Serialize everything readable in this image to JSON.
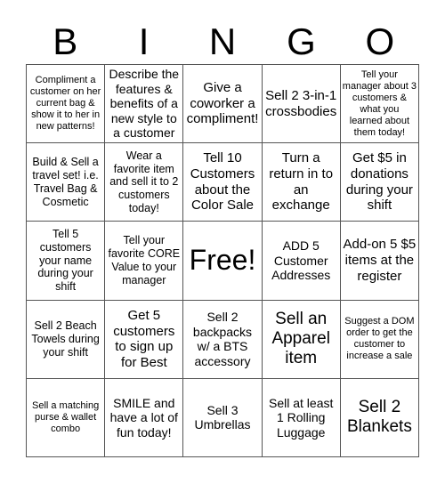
{
  "header": {
    "letters": [
      "B",
      "I",
      "N",
      "G",
      "O"
    ]
  },
  "cells": [
    [
      "Compliment a customer on her current bag & show it to her in new patterns!",
      "Describe the features & benefits of a new style to a customer",
      "Give a coworker a compliment!",
      "Sell 2 3-in-1 crossbodies",
      "Tell your manager about 3 customers & what you learned about them today!"
    ],
    [
      "Build & Sell a travel set! i.e. Travel Bag & Cosmetic",
      "Wear a favorite item and sell it to 2 customers today!",
      "Tell 10 Customers about the Color Sale",
      "Turn a return in to an exchange",
      "Get $5 in donations during your shift"
    ],
    [
      "Tell 5 customers your name during your shift",
      "Tell your favorite CORE Value to your manager",
      "Free!",
      "ADD 5 Customer Addresses",
      "Add-on 5 $5 items at the register"
    ],
    [
      "Sell 2 Beach Towels during your shift",
      "Get 5 customers to sign up for Best",
      "Sell 2 backpacks w/ a BTS accessory",
      "Sell an Apparel item",
      "Suggest a DOM order to get the customer to increase a sale"
    ],
    [
      "Sell a matching purse & wallet combo",
      "SMILE and have a lot of fun today!",
      "Sell 3 Umbrellas",
      "Sell at least 1 Rolling Luggage",
      "Sell 2 Blankets"
    ]
  ]
}
